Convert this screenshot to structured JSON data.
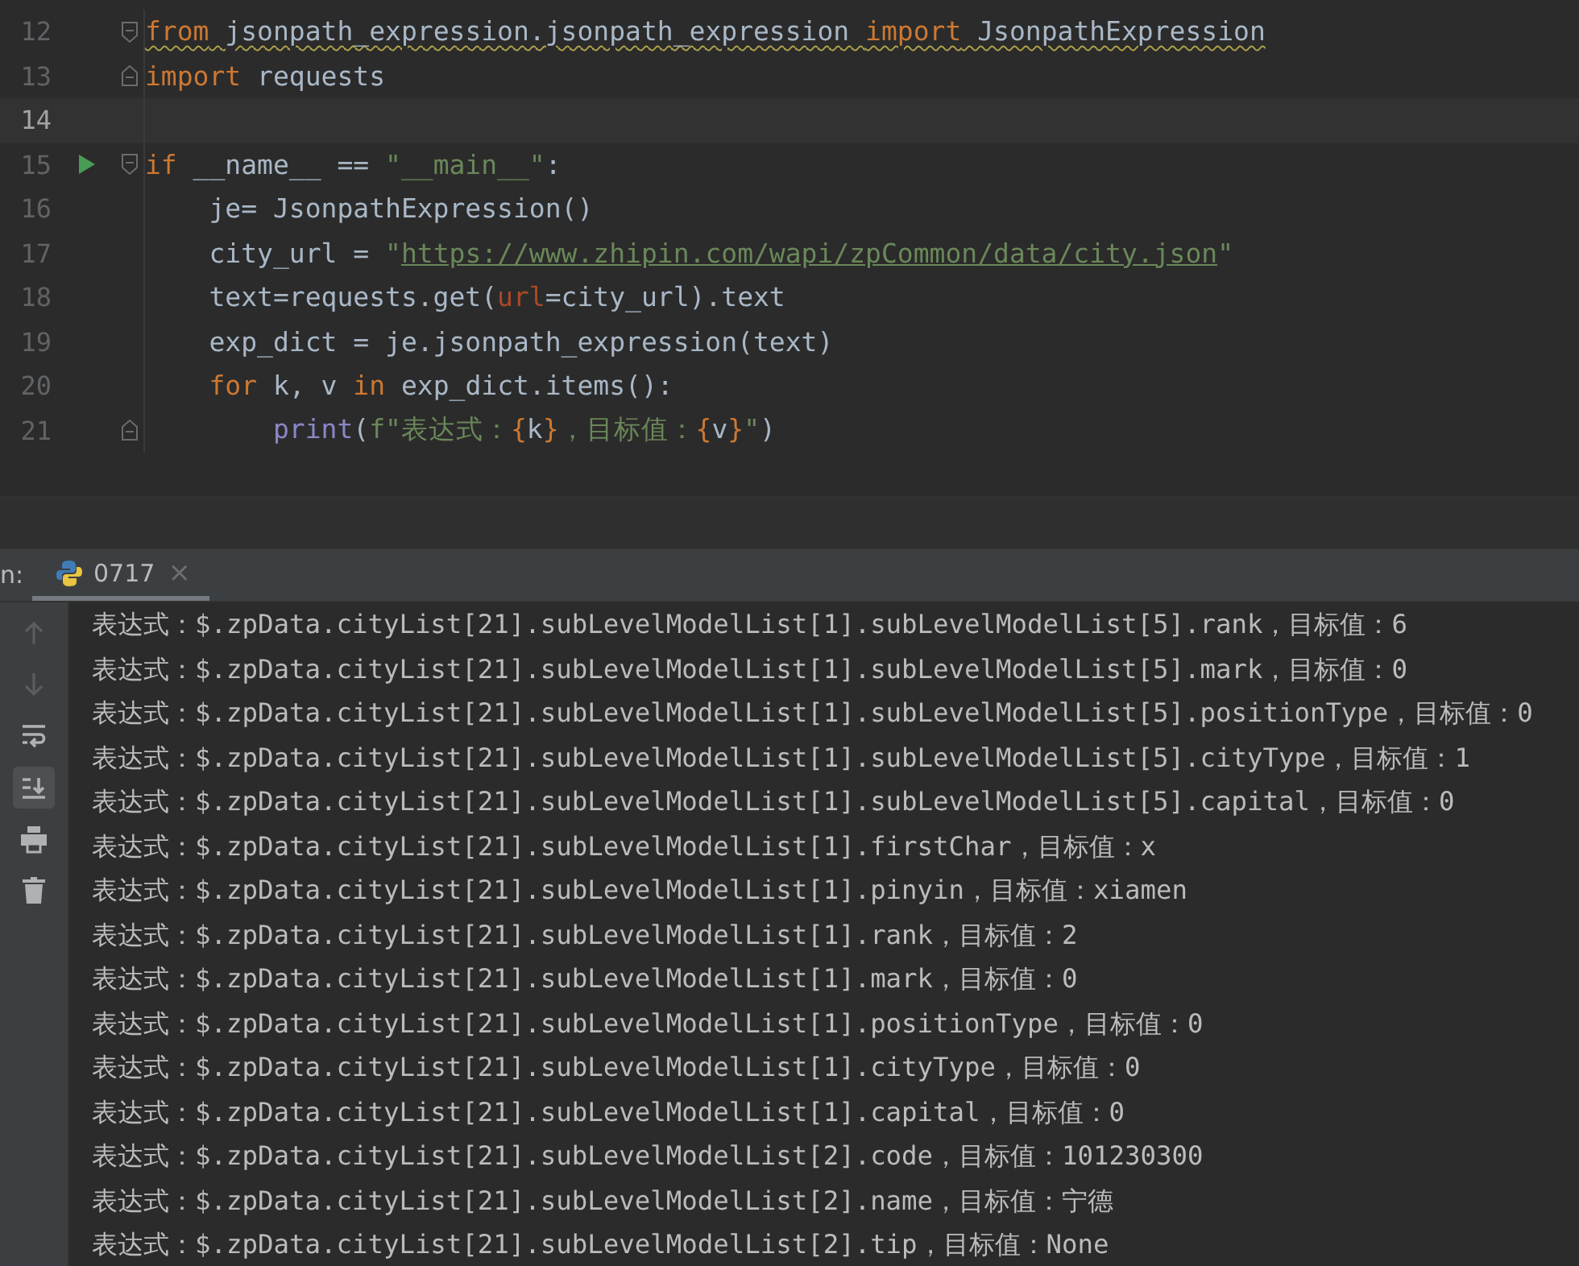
{
  "editor": {
    "lines": [
      {
        "number": "12",
        "fold_start": true,
        "fold_end": false,
        "runnable": false,
        "current": false,
        "warning": true,
        "segments": [
          {
            "text": "from",
            "kind": "keyword"
          },
          {
            "text": " jsonpath_expression.jsonpath_expression ",
            "kind": "plain"
          },
          {
            "text": "import",
            "kind": "keyword"
          },
          {
            "text": " JsonpathExpression",
            "kind": "plain"
          }
        ]
      },
      {
        "number": "13",
        "fold_start": false,
        "fold_end": true,
        "runnable": false,
        "current": false,
        "warning": false,
        "segments": [
          {
            "text": "import",
            "kind": "keyword"
          },
          {
            "text": " requests",
            "kind": "plain"
          }
        ]
      },
      {
        "number": "14",
        "fold_start": false,
        "fold_end": false,
        "runnable": false,
        "current": true
      },
      {
        "number": "15",
        "fold_start": true,
        "fold_end": false,
        "runnable": true,
        "current": false,
        "warning": false,
        "segments": [
          {
            "text": "if",
            "kind": "keyword"
          },
          {
            "text": " __name__ == ",
            "kind": "plain"
          },
          {
            "text": "\"__main__\"",
            "kind": "string"
          },
          {
            "text": ":",
            "kind": "plain"
          }
        ],
        "children": [
          {
            "number": "16",
            "fold_start": false,
            "fold_end": false,
            "runnable": false,
            "current": false,
            "warning": false,
            "segments": [
              {
                "text": "je= JsonpathExpression()",
                "kind": "plain"
              }
            ]
          },
          {
            "number": "17",
            "fold_start": false,
            "fold_end": false,
            "runnable": false,
            "current": false,
            "warning": false,
            "segments": [
              {
                "text": "city_url = ",
                "kind": "plain"
              },
              {
                "text": "\"",
                "kind": "string"
              },
              {
                "text": "https://www.zhipin.com/wapi/zpCommon/data/city.json",
                "kind": "url"
              },
              {
                "text": "\"",
                "kind": "string"
              }
            ]
          },
          {
            "number": "18",
            "fold_start": false,
            "fold_end": false,
            "runnable": false,
            "current": false,
            "warning": false,
            "segments": [
              {
                "text": "text=requests.get(",
                "kind": "plain"
              },
              {
                "text": "url",
                "kind": "param"
              },
              {
                "text": "=city_url).text",
                "kind": "plain"
              }
            ]
          },
          {
            "number": "19",
            "fold_start": false,
            "fold_end": false,
            "runnable": false,
            "current": false,
            "warning": false,
            "segments": [
              {
                "text": "exp_dict = je.jsonpath_expression(text)",
                "kind": "plain"
              }
            ]
          },
          {
            "number": "20",
            "fold_start": false,
            "fold_end": false,
            "runnable": false,
            "current": false,
            "warning": false,
            "segments": [
              {
                "text": "for",
                "kind": "keyword"
              },
              {
                "text": " k, v ",
                "kind": "plain"
              },
              {
                "text": "in",
                "kind": "keyword"
              },
              {
                "text": " exp_dict.items():",
                "kind": "plain"
              }
            ],
            "children": [
              {
                "number": "21",
                "fold_start": false,
                "fold_end": true,
                "runnable": false,
                "current": false,
                "warning": false,
                "segments": [
                  {
                    "text": "print",
                    "kind": "builtin"
                  },
                  {
                    "text": "(",
                    "kind": "plain"
                  },
                  {
                    "text": "f\"表达式：",
                    "kind": "string"
                  },
                  {
                    "text": "{",
                    "kind": "brace"
                  },
                  {
                    "text": "k",
                    "kind": "plain"
                  },
                  {
                    "text": "}",
                    "kind": "brace"
                  },
                  {
                    "text": "，目标值：",
                    "kind": "string"
                  },
                  {
                    "text": "{",
                    "kind": "brace"
                  },
                  {
                    "text": "v",
                    "kind": "plain"
                  },
                  {
                    "text": "}",
                    "kind": "brace"
                  },
                  {
                    "text": "\"",
                    "kind": "string"
                  },
                  {
                    "text": ")",
                    "kind": "plain"
                  }
                ]
              }
            ]
          }
        ]
      }
    ]
  },
  "run_panel": {
    "label": "n:",
    "tabs": [
      {
        "label": "0717",
        "close": "×",
        "selected": true
      }
    ],
    "toolbar": [
      {
        "kind": "up",
        "selected": false
      },
      {
        "kind": "down",
        "selected": false
      },
      {
        "kind": "wrap",
        "selected": false
      },
      {
        "kind": "scroll-end",
        "selected": true
      },
      {
        "kind": "print",
        "selected": false
      },
      {
        "kind": "trash",
        "selected": false
      }
    ],
    "output": [
      "表达式：$.zpData.cityList[21].subLevelModelList[1].subLevelModelList[5].rank，目标值：6",
      "表达式：$.zpData.cityList[21].subLevelModelList[1].subLevelModelList[5].mark，目标值：0",
      "表达式：$.zpData.cityList[21].subLevelModelList[1].subLevelModelList[5].positionType，目标值：0",
      "表达式：$.zpData.cityList[21].subLevelModelList[1].subLevelModelList[5].cityType，目标值：1",
      "表达式：$.zpData.cityList[21].subLevelModelList[1].subLevelModelList[5].capital，目标值：0",
      "表达式：$.zpData.cityList[21].subLevelModelList[1].firstChar，目标值：x",
      "表达式：$.zpData.cityList[21].subLevelModelList[1].pinyin，目标值：xiamen",
      "表达式：$.zpData.cityList[21].subLevelModelList[1].rank，目标值：2",
      "表达式：$.zpData.cityList[21].subLevelModelList[1].mark，目标值：0",
      "表达式：$.zpData.cityList[21].subLevelModelList[1].positionType，目标值：0",
      "表达式：$.zpData.cityList[21].subLevelModelList[1].cityType，目标值：0",
      "表达式：$.zpData.cityList[21].subLevelModelList[1].capital，目标值：0",
      "表达式：$.zpData.cityList[21].subLevelModelList[2].code，目标值：101230300",
      "表达式：$.zpData.cityList[21].subLevelModelList[2].name，目标值：宁德",
      "表达式：$.zpData.cityList[21].subLevelModelList[2].tip，目标值：None"
    ]
  }
}
